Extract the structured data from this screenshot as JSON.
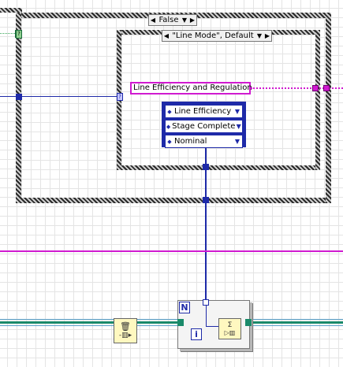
{
  "outer_case": {
    "selector_label": "False"
  },
  "inner_case": {
    "selector_label": "\"Line Mode\", Default"
  },
  "string_constant": "Line Efficiency and Regulation",
  "enum_constants": [
    {
      "label": "Line Efficiency"
    },
    {
      "label": "Stage Complete"
    },
    {
      "label": "Nominal"
    }
  ],
  "loop": {
    "count_terminal": "N",
    "iteration_terminal": "i"
  },
  "glyphs": {
    "left_arrow": "◀",
    "right_arrow": "▶",
    "dropdown": "▼",
    "updown": "◆",
    "question": "?",
    "trash": "🗑",
    "sigma": "Σ"
  },
  "colors": {
    "enum_blue": "#1e2aa8",
    "string_pink": "#d01ad0",
    "cluster_green": "#1a8a6a",
    "frame_gray": "#505050"
  }
}
